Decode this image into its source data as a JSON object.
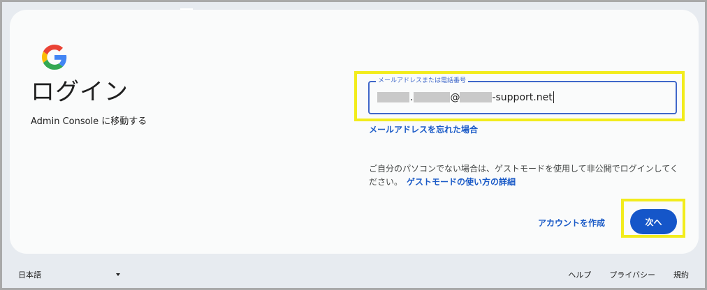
{
  "header": {
    "title": "ログイン",
    "subtitle": "Admin Console に移動する"
  },
  "brand": {
    "logo_icon": "google-g-logo",
    "colors": {
      "blue": "#4285F4",
      "red": "#EA4335",
      "yellow": "#FBBC05",
      "green": "#34A853"
    }
  },
  "email_field": {
    "label": "メールアドレスまたは電話番号",
    "value_suffix": "-support.net",
    "value_separator_dot": ".",
    "value_at": "@"
  },
  "links": {
    "forgot_email": "メールアドレスを忘れた場合",
    "guest_mode_help": "ゲストモードの使い方の詳細",
    "create_account": "アカウントを作成"
  },
  "guest_note": {
    "text": "ご自分のパソコンでない場合は、ゲストモードを使用して非公開でログインしてください。"
  },
  "actions": {
    "next_label": "次へ"
  },
  "footer": {
    "language": "日本語",
    "help": "ヘルプ",
    "privacy": "プライバシー",
    "terms": "規約"
  },
  "colors": {
    "accent": "#1556c9",
    "link": "#1a5ac7",
    "field_border": "#3f67c9",
    "annotation_highlight": "#f2ec1c"
  }
}
